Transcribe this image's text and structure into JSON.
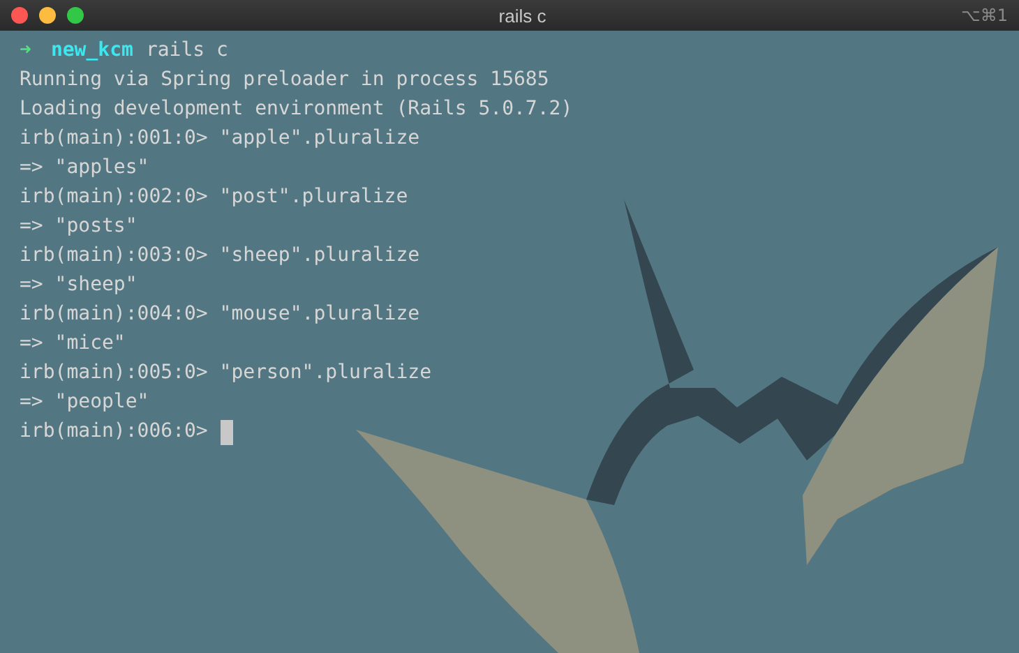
{
  "window": {
    "title": "rails c",
    "shortcut": "⌥⌘1"
  },
  "prompt": {
    "arrow": "➜",
    "directory": "new_kcm",
    "command": "rails c"
  },
  "lines": [
    "Running via Spring preloader in process 15685",
    "Loading development environment (Rails 5.0.7.2)",
    "irb(main):001:0> \"apple\".pluralize",
    "=> \"apples\"",
    "irb(main):002:0> \"post\".pluralize",
    "=> \"posts\"",
    "irb(main):003:0> \"sheep\".pluralize",
    "=> \"sheep\"",
    "irb(main):004:0> \"mouse\".pluralize",
    "=> \"mice\"",
    "irb(main):005:0> \"person\".pluralize",
    "=> \"people\""
  ],
  "current": {
    "prompt": "irb(main):006:0>"
  }
}
